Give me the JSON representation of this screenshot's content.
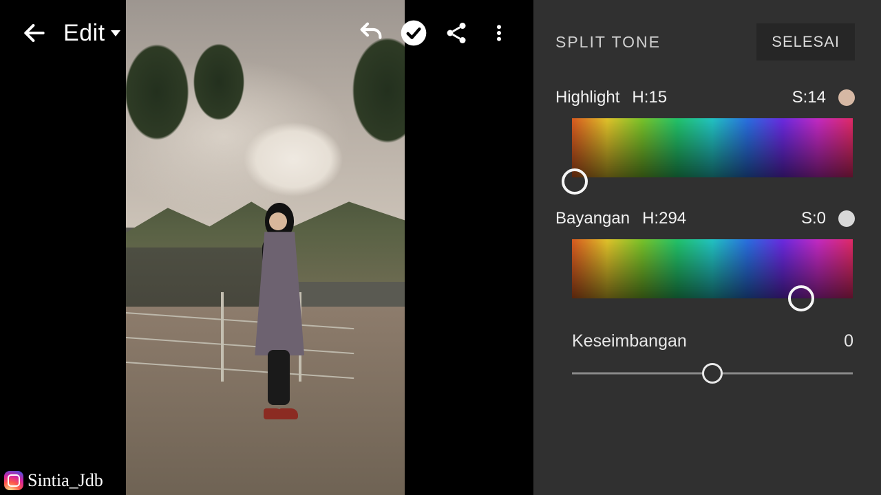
{
  "topbar": {
    "title": "Edit"
  },
  "credit": {
    "handle": "Sintia_Jdb"
  },
  "panel": {
    "title": "SPLIT TONE",
    "done_label": "SELESAI",
    "highlight": {
      "label": "Highlight",
      "h_label": "H:15",
      "s_label": "S:14",
      "hue": 15,
      "sat": 14
    },
    "shadow": {
      "label": "Bayangan",
      "h_label": "H:294",
      "s_label": "S:0",
      "hue": 294,
      "sat": 0
    },
    "balance": {
      "label": "Keseimbangan",
      "value": "0",
      "num": 0
    }
  }
}
